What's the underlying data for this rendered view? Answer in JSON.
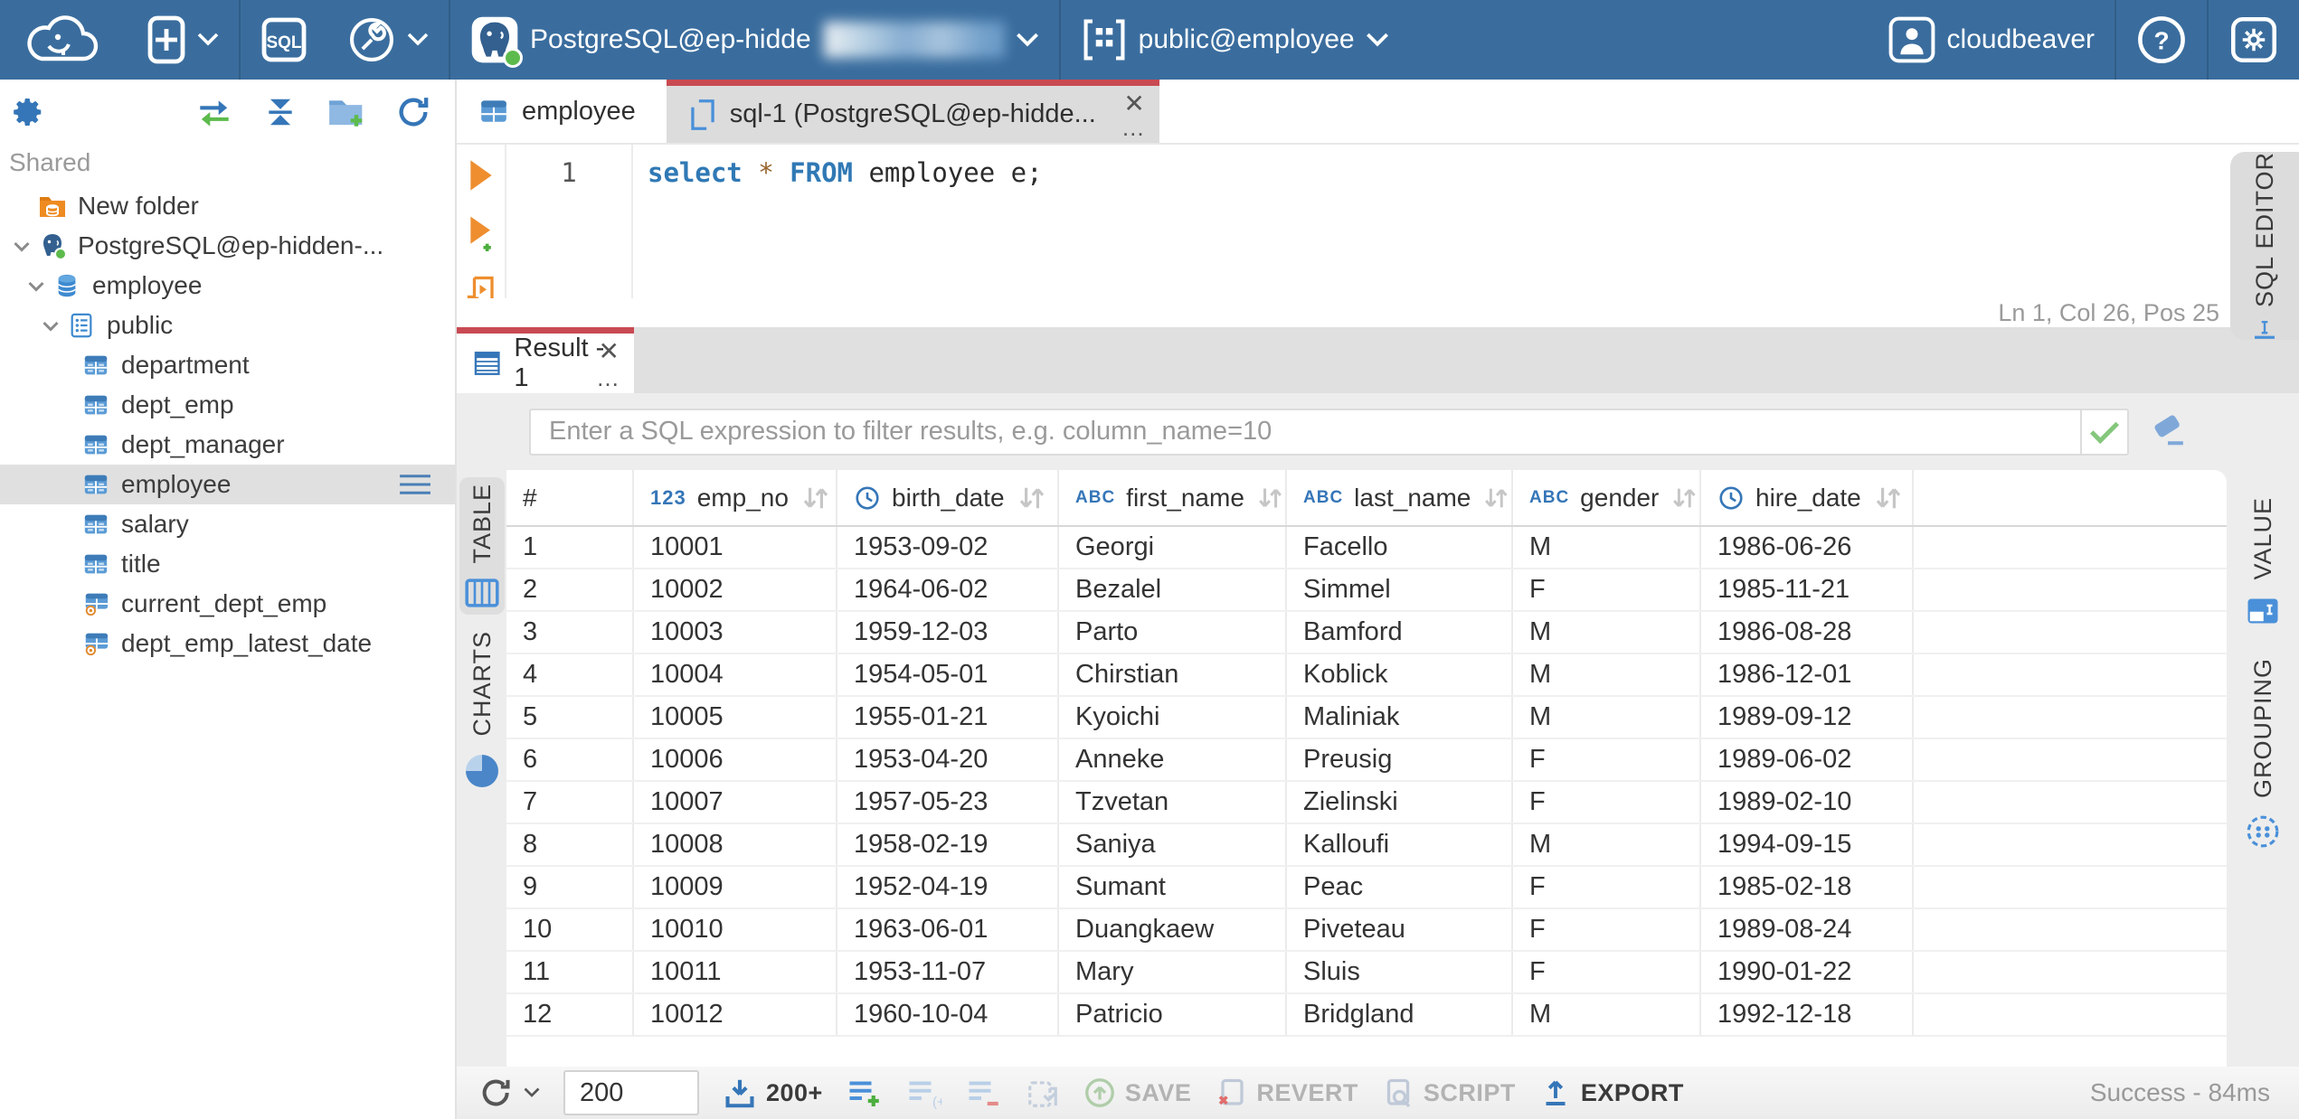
{
  "topbar": {
    "sql_badge_label": "SQL",
    "connection_label": "PostgreSQL@ep-hidde",
    "schema_label": "public@employee",
    "user_label": "cloudbeaver",
    "help_label": "?"
  },
  "sidebar": {
    "section": "Shared",
    "tree": [
      {
        "label": "New folder",
        "icon": "folder-database",
        "level": 0,
        "chevron": false,
        "selected": false
      },
      {
        "label": "PostgreSQL@ep-hidden-...",
        "icon": "postgresql",
        "level": 0,
        "chevron": true,
        "selected": false
      },
      {
        "label": "employee",
        "icon": "database",
        "level": 1,
        "chevron": true,
        "selected": false
      },
      {
        "label": "public",
        "icon": "schema",
        "level": 2,
        "chevron": true,
        "selected": false
      },
      {
        "label": "department",
        "icon": "table",
        "level": 3,
        "chevron": false,
        "selected": false
      },
      {
        "label": "dept_emp",
        "icon": "table",
        "level": 3,
        "chevron": false,
        "selected": false
      },
      {
        "label": "dept_manager",
        "icon": "table",
        "level": 3,
        "chevron": false,
        "selected": false
      },
      {
        "label": "employee",
        "icon": "table",
        "level": 3,
        "chevron": false,
        "selected": true
      },
      {
        "label": "salary",
        "icon": "table",
        "level": 3,
        "chevron": false,
        "selected": false
      },
      {
        "label": "title",
        "icon": "table",
        "level": 3,
        "chevron": false,
        "selected": false
      },
      {
        "label": "current_dept_emp",
        "icon": "view",
        "level": 3,
        "chevron": false,
        "selected": false
      },
      {
        "label": "dept_emp_latest_date",
        "icon": "view",
        "level": 3,
        "chevron": false,
        "selected": false
      }
    ]
  },
  "editor": {
    "tabs": [
      {
        "label": "employee",
        "icon": "table",
        "active": false
      },
      {
        "label": "sql-1 (PostgreSQL@ep-hidde...",
        "icon": "sql-script",
        "active": true
      }
    ],
    "line_number": "1",
    "code_tokens": [
      {
        "text": "select",
        "cls": "kw"
      },
      {
        "text": " ",
        "cls": "plain"
      },
      {
        "text": "*",
        "cls": "op"
      },
      {
        "text": " ",
        "cls": "plain"
      },
      {
        "text": "FROM",
        "cls": "kw"
      },
      {
        "text": " employee e;",
        "cls": "plain"
      }
    ],
    "status": "Ln 1, Col 26, Pos 25"
  },
  "result": {
    "tab_label": "Result - 1",
    "filter": {
      "placeholder": "Enter a SQL expression to filter results, e.g. column_name=10"
    },
    "rails": {
      "left": [
        {
          "label": "TABLE",
          "selected": true
        },
        {
          "label": "CHARTS",
          "selected": false
        }
      ],
      "right_top": {
        "label": "SQL EDITOR"
      },
      "right": [
        {
          "label": "VALUE"
        },
        {
          "label": "GROUPING"
        }
      ]
    },
    "table": {
      "columns": [
        {
          "name": "#",
          "type": "index"
        },
        {
          "name": "emp_no",
          "type": "number"
        },
        {
          "name": "birth_date",
          "type": "datetime"
        },
        {
          "name": "first_name",
          "type": "string"
        },
        {
          "name": "last_name",
          "type": "string"
        },
        {
          "name": "gender",
          "type": "string"
        },
        {
          "name": "hire_date",
          "type": "datetime"
        }
      ],
      "rows": [
        [
          "1",
          "10001",
          "1953-09-02",
          "Georgi",
          "Facello",
          "M",
          "1986-06-26"
        ],
        [
          "2",
          "10002",
          "1964-06-02",
          "Bezalel",
          "Simmel",
          "F",
          "1985-11-21"
        ],
        [
          "3",
          "10003",
          "1959-12-03",
          "Parto",
          "Bamford",
          "M",
          "1986-08-28"
        ],
        [
          "4",
          "10004",
          "1954-05-01",
          "Chirstian",
          "Koblick",
          "M",
          "1986-12-01"
        ],
        [
          "5",
          "10005",
          "1955-01-21",
          "Kyoichi",
          "Maliniak",
          "M",
          "1989-09-12"
        ],
        [
          "6",
          "10006",
          "1953-04-20",
          "Anneke",
          "Preusig",
          "F",
          "1989-06-02"
        ],
        [
          "7",
          "10007",
          "1957-05-23",
          "Tzvetan",
          "Zielinski",
          "F",
          "1989-02-10"
        ],
        [
          "8",
          "10008",
          "1958-02-19",
          "Saniya",
          "Kalloufi",
          "M",
          "1994-09-15"
        ],
        [
          "9",
          "10009",
          "1952-04-19",
          "Sumant",
          "Peac",
          "F",
          "1985-02-18"
        ],
        [
          "10",
          "10010",
          "1963-06-01",
          "Duangkaew",
          "Piveteau",
          "F",
          "1989-08-24"
        ],
        [
          "11",
          "10011",
          "1953-11-07",
          "Mary",
          "Sluis",
          "F",
          "1990-01-22"
        ],
        [
          "12",
          "10012",
          "1960-10-04",
          "Patricio",
          "Bridgland",
          "M",
          "1992-12-18"
        ]
      ]
    },
    "toolbar": {
      "row_limit": "200",
      "fetch_label": "200+",
      "save_label": "SAVE",
      "revert_label": "REVERT",
      "script_label": "SCRIPT",
      "export_label": "EXPORT",
      "status": "Success - 84ms"
    }
  }
}
